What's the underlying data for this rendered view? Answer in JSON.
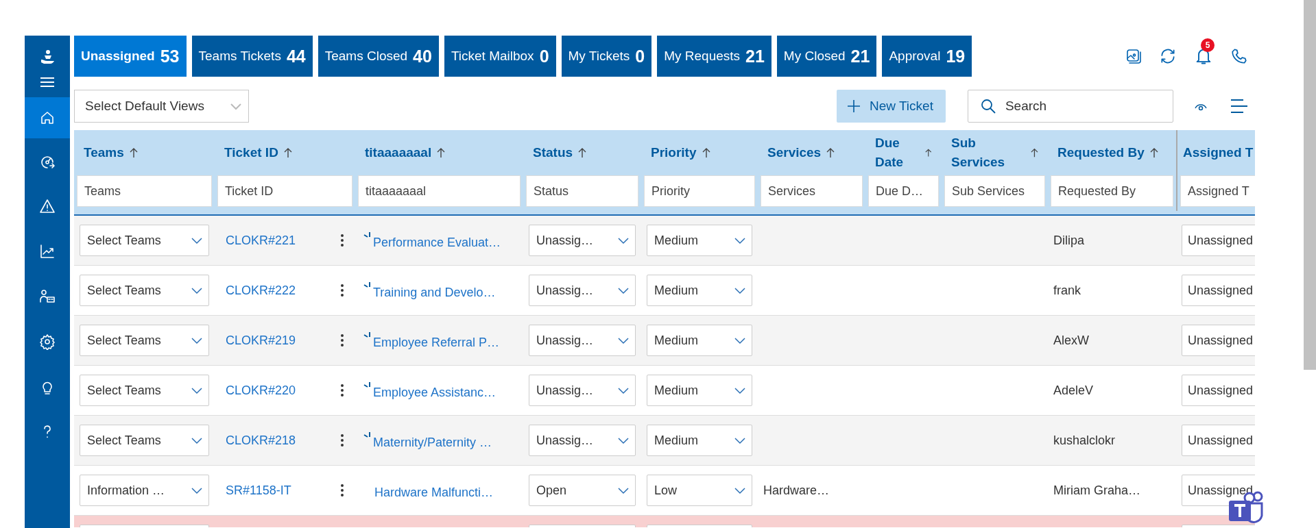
{
  "sidebar": {
    "items": [
      {
        "kind": "logo",
        "selected": false
      },
      {
        "kind": "menu",
        "selected": false
      },
      {
        "kind": "home",
        "selected": true
      },
      {
        "kind": "gauge",
        "selected": false
      },
      {
        "kind": "warning",
        "selected": false
      },
      {
        "kind": "chart",
        "selected": false
      },
      {
        "kind": "people",
        "selected": false
      },
      {
        "kind": "gear",
        "selected": false
      },
      {
        "kind": "bulb",
        "selected": false
      },
      {
        "kind": "help",
        "selected": false
      }
    ]
  },
  "tabs": [
    {
      "label": "Unassigned",
      "count": "53",
      "selected": true
    },
    {
      "label": "Teams Tickets",
      "count": "44",
      "selected": false
    },
    {
      "label": "Teams Closed",
      "count": "40",
      "selected": false
    },
    {
      "label": "Ticket Mailbox",
      "count": "0",
      "selected": false
    },
    {
      "label": "My Tickets",
      "count": "0",
      "selected": false
    },
    {
      "label": "My Requests",
      "count": "21",
      "selected": false
    },
    {
      "label": "My Closed",
      "count": "21",
      "selected": false
    },
    {
      "label": "Approval",
      "count": "19",
      "selected": false
    }
  ],
  "notifications": {
    "count": "5"
  },
  "views_dropdown": {
    "value": "Select Default Views"
  },
  "new_ticket_button": {
    "label": "New Ticket"
  },
  "search": {
    "placeholder": "Search"
  },
  "table": {
    "columns": [
      {
        "label": "Teams",
        "filter_placeholder": "Teams"
      },
      {
        "label": "Ticket ID",
        "filter_placeholder": "Ticket ID"
      },
      {
        "label": "titaaaaaaal",
        "filter_placeholder": "titaaaaaaal"
      },
      {
        "label": "Status",
        "filter_placeholder": "Status"
      },
      {
        "label": "Priority",
        "filter_placeholder": "Priority"
      },
      {
        "label": "Services",
        "filter_placeholder": "Services"
      },
      {
        "label": "Due Date",
        "filter_placeholder": "Due D…"
      },
      {
        "label": "Sub Services",
        "filter_placeholder": "Sub Services"
      },
      {
        "label": "Requested By",
        "filter_placeholder": "Requested By"
      },
      {
        "label": "Assigned T",
        "filter_placeholder": "Assigned T"
      }
    ],
    "rows": [
      {
        "teams": "Select Teams",
        "ticket_id": "CLOKR#221",
        "loading": true,
        "title": "Performance Evaluat…",
        "status": "Unassig…",
        "priority": "Medium",
        "requested_by": "Dilipa",
        "assigned_to": "Unassigned",
        "alert": false
      },
      {
        "teams": "Select Teams",
        "ticket_id": "CLOKR#222",
        "loading": true,
        "title": "Training and Develo…",
        "status": "Unassig…",
        "priority": "Medium",
        "requested_by": "frank",
        "assigned_to": "Unassigned",
        "alert": false
      },
      {
        "teams": "Select Teams",
        "ticket_id": "CLOKR#219",
        "loading": true,
        "title": "Employee Referral P…",
        "status": "Unassig…",
        "priority": "Medium",
        "requested_by": "AlexW",
        "assigned_to": "Unassigned",
        "alert": false
      },
      {
        "teams": "Select Teams",
        "ticket_id": "CLOKR#220",
        "loading": true,
        "title": "Employee Assistanc…",
        "status": "Unassig…",
        "priority": "Medium",
        "requested_by": "AdeleV",
        "assigned_to": "Unassigned",
        "alert": false
      },
      {
        "teams": "Select Teams",
        "ticket_id": "CLOKR#218",
        "loading": true,
        "title": "Maternity/Paternity …",
        "status": "Unassig…",
        "priority": "Medium",
        "requested_by": "kushalclokr",
        "assigned_to": "Unassigned",
        "alert": false
      },
      {
        "teams": "Information …",
        "ticket_id": "SR#1158-IT",
        "loading": false,
        "title": "Hardware Malfuncti…",
        "status": "Open",
        "priority": "Low",
        "services": "Hardware…",
        "requested_by": "Miriam Graha…",
        "assigned_to": "Unassigned",
        "alert": false
      },
      {
        "loading": false,
        "alert": true
      }
    ]
  }
}
